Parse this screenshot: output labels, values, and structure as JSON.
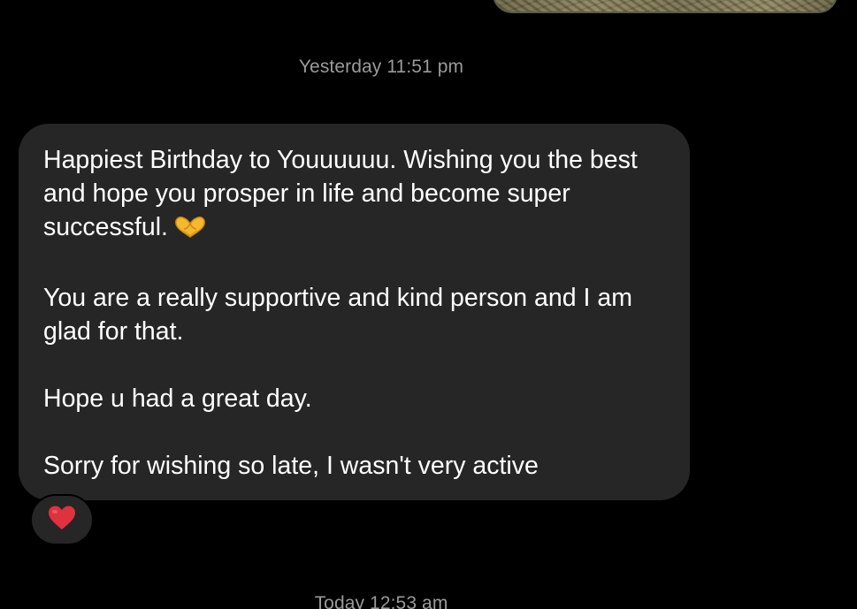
{
  "conversation": {
    "timestamps": {
      "yesterday": "Yesterday 11:51 pm",
      "today": "Today 12:53 am"
    },
    "message": {
      "paragraphs": [
        "Happiest Birthday to Youuuuuu. Wishing you the best and hope you prosper in life and become super successful.",
        "You are a really supportive and kind person and I am glad for that.",
        "Hope u had a great day.",
        "Sorry for wishing so late, I wasn't very active"
      ],
      "emoji": "heart-hands-icon"
    },
    "reaction": {
      "icon": "red-heart-icon",
      "color": "#e0313e"
    },
    "colors": {
      "background": "#000000",
      "bubble": "#262626",
      "timestamp_text": "#9a9a9a",
      "message_text": "#ffffff",
      "emoji": "#f5b82e"
    }
  }
}
